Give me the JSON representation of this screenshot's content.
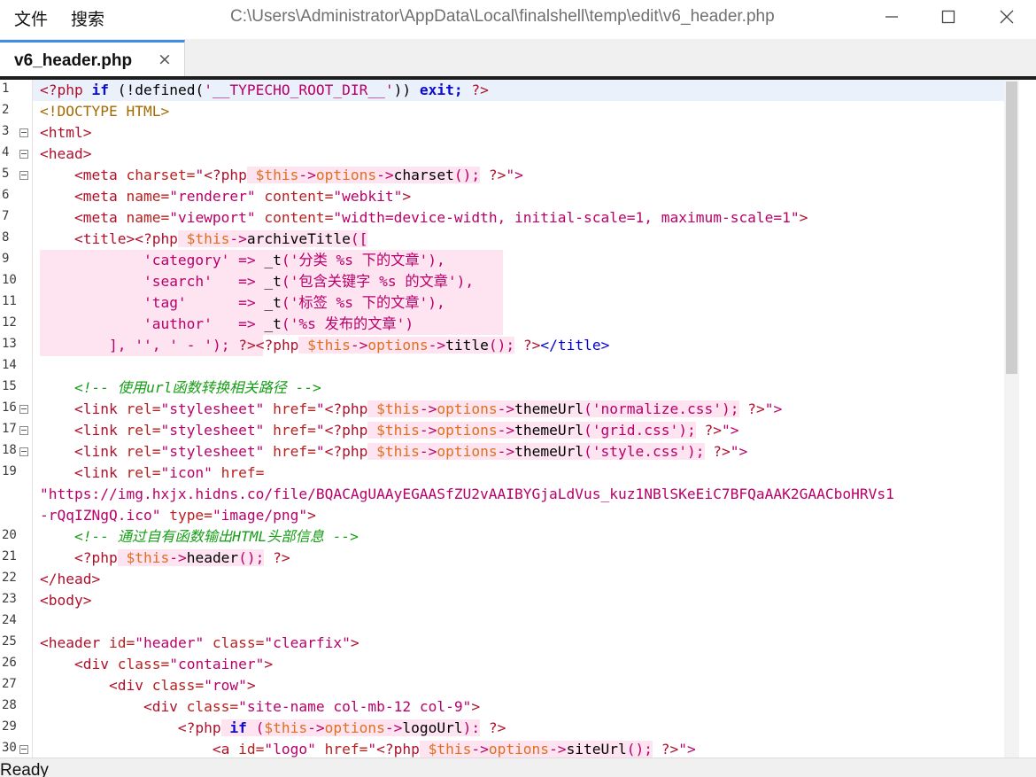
{
  "menu": {
    "file": "文件",
    "search": "搜索"
  },
  "window": {
    "title": "C:\\Users\\Administrator\\AppData\\Local\\finalshell\\temp\\edit\\v6_header.php"
  },
  "tab": {
    "label": "v6_header.php",
    "close_glyph": "×"
  },
  "status": {
    "text": "Ready"
  },
  "lines": [
    {
      "n": "1"
    },
    {
      "n": "2"
    },
    {
      "n": "3"
    },
    {
      "n": "4"
    },
    {
      "n": "5"
    },
    {
      "n": "6"
    },
    {
      "n": "7"
    },
    {
      "n": "8"
    },
    {
      "n": "9"
    },
    {
      "n": "10"
    },
    {
      "n": "11"
    },
    {
      "n": "12"
    },
    {
      "n": "13"
    },
    {
      "n": "14"
    },
    {
      "n": "15"
    },
    {
      "n": "16"
    },
    {
      "n": "17"
    },
    {
      "n": "18"
    },
    {
      "n": "19"
    },
    {
      "n": ""
    },
    {
      "n": ""
    },
    {
      "n": "20"
    },
    {
      "n": "21"
    },
    {
      "n": "22"
    },
    {
      "n": "23"
    },
    {
      "n": "24"
    },
    {
      "n": "25"
    },
    {
      "n": "26"
    },
    {
      "n": "27"
    },
    {
      "n": "28"
    },
    {
      "n": "29"
    },
    {
      "n": "30"
    }
  ],
  "code": {
    "l1a": "<?php",
    "l1b": " if",
    " l1c": "",
    "l1c": " (!defined(",
    "l1d": "'__TYPECHO_ROOT_DIR__'",
    "l1e": "))",
    "l1f": " exit;",
    "l1g": " ?>",
    "l2": "<!DOCTYPE HTML>",
    "l3": "<html>",
    "l4": "<head>",
    "l5a": "    <meta",
    "l5b": " charset=",
    "l5c": "\"",
    "l5d": "<?php",
    "l5e": " $this",
    "l5f": "->",
    "l5g": "options",
    "l5h": "->",
    "l5i": "charset",
    "l5j": "();",
    "l5k": " ?>",
    "l5l": "\">",
    "l6a": "    <meta",
    "l6b": " name=",
    "l6c": "\"renderer\"",
    "l6d": " content=",
    "l6e": "\"webkit\"",
    "l6f": ">",
    "l7a": "    <meta",
    "l7b": " name=",
    "l7c": "\"viewport\"",
    "l7d": " content=",
    "l7e": "\"width=device-width, initial-scale=1, maximum-scale=1\"",
    "l7f": ">",
    "l8a": "    <title>",
    "l8b": "<?php",
    "l8c": " $this",
    "l8d": "->",
    "l8e": "archiveTitle",
    "l8f": "([",
    "l9a": "            ",
    "l9b": "'category'",
    "l9c": " => ",
    "l9d": "_t",
    "l9e": "(",
    "l9f": "'分类 %s 下的文章'",
    "l9g": "),",
    "l10a": "            ",
    "l10b": "'search'",
    "l10c": "   => ",
    "l10d": "_t",
    "l10e": "(",
    "l10f": "'包含关键字 %s 的文章'",
    "l10g": "),",
    "l11a": "            ",
    "l11b": "'tag'",
    "l11c": "      => ",
    "l11d": "_t",
    "l11e": "(",
    "l11f": "'标签 %s 下的文章'",
    "l11g": "),",
    "l12a": "            ",
    "l12b": "'author'",
    "l12c": "   => ",
    "l12d": "_t",
    "l12e": "(",
    "l12f": "'%s 发布的文章'",
    "l12g": ")",
    "l13a": "        ",
    "l13b": "], ",
    "l13c": "''",
    "l13d": ", ",
    "l13e": "' - '",
    "l13f": ");",
    "l13g": " ?>",
    "l13h": "<?php",
    "l13i": " $this",
    "l13j": "->",
    "l13k": "options",
    "l13l": "->",
    "l13m": "title",
    "l13n": "();",
    "l13o": " ?>",
    "l13p": "</title>",
    "l15": "    <!-- 使用url函数转换相关路径 -->",
    "l16a": "    <link",
    "l16b": " rel=",
    "l16c": "\"stylesheet\"",
    "l16d": " href=",
    "l16e": "\"",
    "l16f": "<?php",
    "l16g": " $this",
    "l16h": "->",
    "l16i": "options",
    "l16j": "->",
    "l16k": "themeUrl",
    "l16l": "(",
    "l16m": "'normalize.css'",
    "l16n": ");",
    "l16o": " ?>",
    "l16p": "\">",
    "l17m": "'grid.css'",
    "l18m": "'style.css'",
    "l19a": "    <link",
    "l19b": " rel=",
    "l19c": "\"icon\"",
    "l19d": " href=",
    "l19e": "\"https://img.hxjx.hidns.co/file/BQACAgUAAyEGAASfZU2vAAIBYGjaLdVus_kuz1NBlSKeEiC7BFQaAAK2GAACboHRVs1",
    "l19f": "-rQqIZNgQ.ico\"",
    "l19g": " type=",
    "l19h": "\"image/png\"",
    "l19i": ">",
    "l20": "    <!-- 通过自有函数输出HTML头部信息 -->",
    "l21a": "    <?php",
    "l21b": " $this",
    "l21c": "->",
    "l21d": "header",
    "l21e": "();",
    "l21f": " ?>",
    "l22": "</head>",
    "l23": "<body>",
    "l25a": "<header",
    "l25b": " id=",
    "l25c": "\"header\"",
    "l25d": " class=",
    "l25e": "\"clearfix\"",
    "l25f": ">",
    "l26a": "    <div",
    "l26b": " class=",
    "l26c": "\"container\"",
    "l26d": ">",
    "l27a": "        <div",
    "l27b": " class=",
    "l27c": "\"row\"",
    "l27d": ">",
    "l28a": "            <div",
    "l28b": " class=",
    "l28c": "\"site-name col-mb-12 col-9\"",
    "l28d": ">",
    "l29a": "                <?php",
    "l29b": " if",
    "l29c": " (",
    "l29d": "$this",
    "l29e": "->",
    "l29f": "options",
    "l29g": "->",
    "l29h": "logoUrl",
    "l29i": "):",
    "l29j": " ?>",
    "l30a": "                    <a",
    "l30b": " id=",
    "l30c": "\"logo\"",
    "l30d": " href=",
    "l30e": "\"",
    "l30f": "<?php",
    "l30g": " $this",
    "l30h": "->",
    "l30i": "options",
    "l30j": "->",
    "l30k": "siteUrl",
    "l30l": "();",
    "l30m": " ?>",
    "l30n": "\">"
  }
}
